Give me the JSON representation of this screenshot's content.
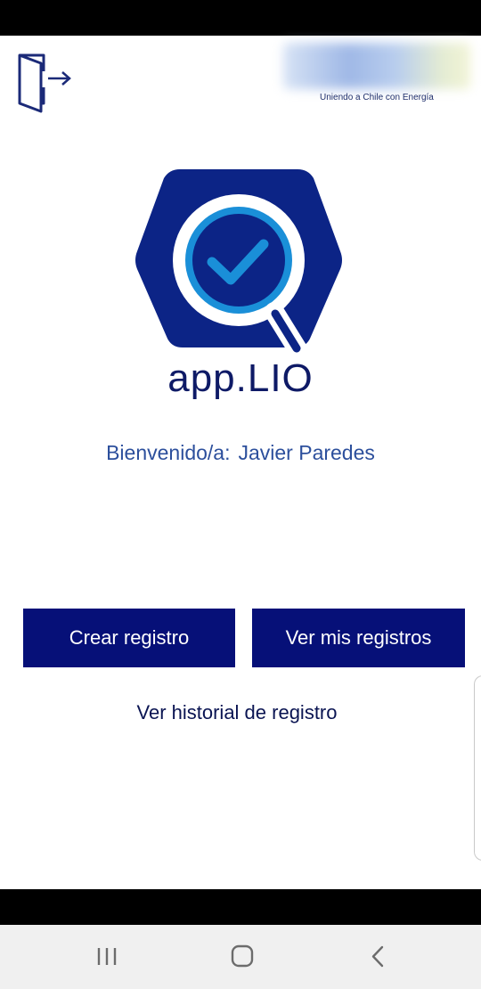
{
  "header": {
    "logout_icon": "logout-door-icon",
    "brand_tagline": "Uniendo a Chile con Energía"
  },
  "logo": {
    "icon": "magnifier-check-hexagon-icon",
    "app_name": "app.LIO"
  },
  "welcome": {
    "greeting": "Bienvenido/a:",
    "user_name": "Javier Paredes"
  },
  "actions": {
    "create_label": "Crear registro",
    "mine_label": "Ver mis registros",
    "history_label": "Ver historial de registro"
  },
  "system_nav": {
    "recents_icon": "recents-icon",
    "home_icon": "home-icon",
    "back_icon": "back-icon"
  },
  "colors": {
    "primary": "#061078",
    "hexagon": "#0c2486",
    "accent": "#1a8fd8",
    "text_blue": "#2c4f9c"
  }
}
